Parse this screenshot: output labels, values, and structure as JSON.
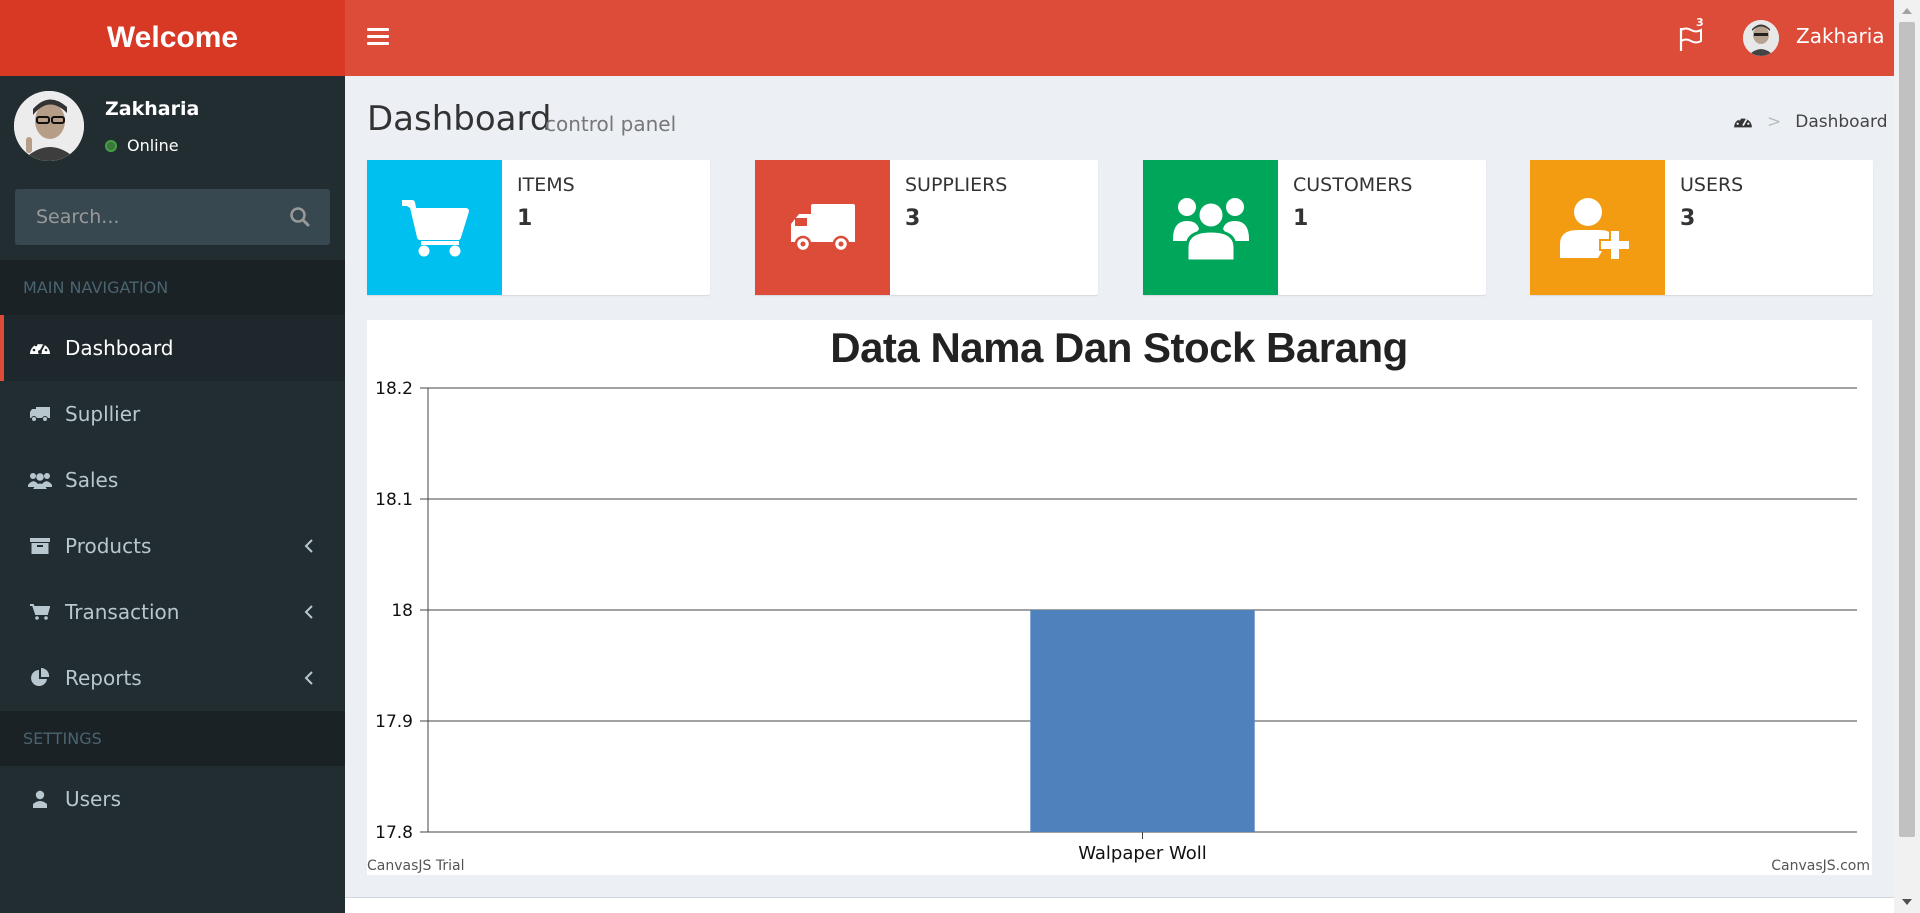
{
  "header": {
    "logo": "Welcome",
    "notifications_count": "3",
    "user_name": "Zakharia"
  },
  "sidebar": {
    "user": {
      "name": "Zakharia",
      "status": "Online"
    },
    "search": {
      "placeholder": "Search..."
    },
    "main_nav_header": "MAIN NAVIGATION",
    "settings_header": "SETTINGS",
    "items": [
      {
        "label": "Dashboard",
        "icon": "dashboard-icon",
        "active": true
      },
      {
        "label": "Supllier",
        "icon": "truck-icon"
      },
      {
        "label": "Sales",
        "icon": "users-icon"
      },
      {
        "label": "Products",
        "icon": "archive-icon",
        "has_children": true
      },
      {
        "label": "Transaction",
        "icon": "cart-icon",
        "has_children": true
      },
      {
        "label": "Reports",
        "icon": "pie-chart-icon",
        "has_children": true
      },
      {
        "label": "Users",
        "icon": "user-icon"
      }
    ]
  },
  "page": {
    "title": "Dashboard",
    "subtitle": "control panel",
    "breadcrumb": "Dashboard"
  },
  "info_boxes": [
    {
      "label": "ITEMS",
      "value": "1",
      "color": "#00c0ef",
      "icon": "cart-icon"
    },
    {
      "label": "SUPPLIERS",
      "value": "3",
      "color": "#dd4b39",
      "icon": "truck-icon"
    },
    {
      "label": "CUSTOMERS",
      "value": "1",
      "color": "#00a65a",
      "icon": "users-icon"
    },
    {
      "label": "USERS",
      "value": "3",
      "color": "#f39c12",
      "icon": "user-plus-icon"
    }
  ],
  "colors": {
    "header": "#dd4b39",
    "logo_bg": "#d73925",
    "sidebar": "#222d32",
    "bar": "#4f81bc"
  },
  "chart_data": {
    "type": "bar",
    "title": "Data Nama Dan Stock Barang",
    "categories": [
      "Walpaper Woll"
    ],
    "values": [
      18
    ],
    "ylim": [
      17.8,
      18.2
    ],
    "yticks": [
      "17.8",
      "17.9",
      "18",
      "18.1",
      "18.2"
    ],
    "grid": true,
    "xlabel": "",
    "ylabel": "",
    "credit_left": "CanvasJS Trial",
    "credit_right": "CanvasJS.com"
  }
}
